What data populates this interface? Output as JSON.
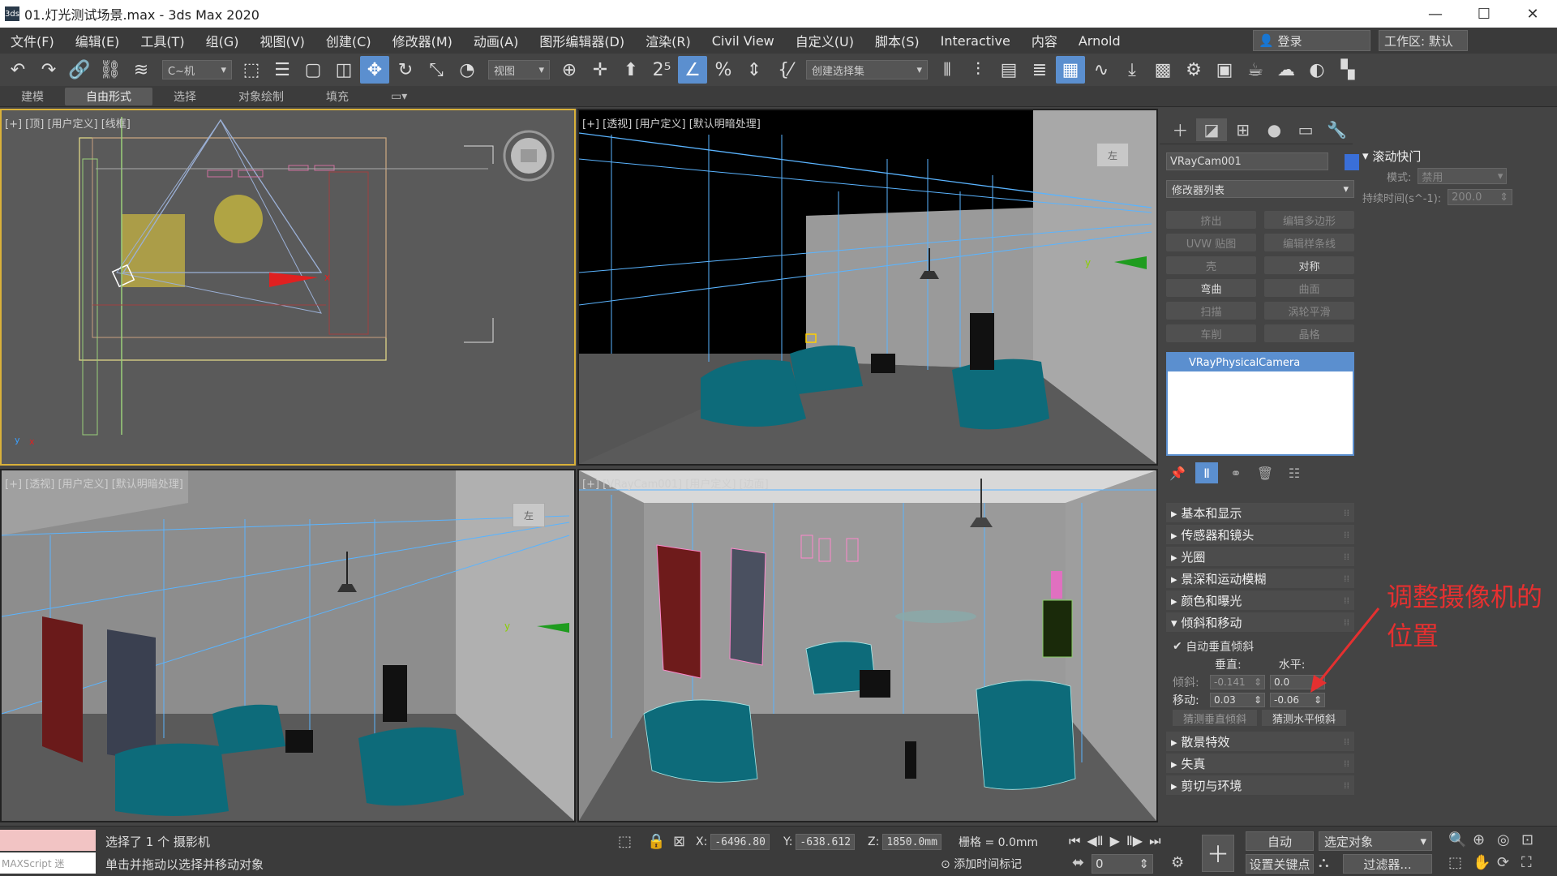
{
  "title": "01.灯光测试场景.max - 3ds Max 2020",
  "app_icon": "3ds",
  "menu": [
    "文件(F)",
    "编辑(E)",
    "工具(T)",
    "组(G)",
    "视图(V)",
    "创建(C)",
    "修改器(M)",
    "动画(A)",
    "图形编辑器(D)",
    "渲染(R)",
    "Civil View",
    "自定义(U)",
    "脚本(S)",
    "Interactive",
    "内容",
    "Arnold"
  ],
  "login": "登录",
  "workspace": "工作区: 默认",
  "toolbar": {
    "selection_filter": "C~机",
    "ref_coord": "视图",
    "named_selection": "创建选择集"
  },
  "ribbon_tabs": [
    "建模",
    "自由形式",
    "选择",
    "对象绘制",
    "填充"
  ],
  "viewports": {
    "top": {
      "label": "[+] [顶] [用户定义] [线框]"
    },
    "persp": {
      "label": "[+] [透视] [用户定义] [默认明暗处理]",
      "cube": "左"
    },
    "persp2": {
      "label": "[+] [透视] [用户定义] [默认明暗处理]",
      "cube": "左"
    },
    "camera": {
      "label": "[+] [VRayCam001] [用户定义] [边面]"
    }
  },
  "command_panel": {
    "object_name": "VRayCam001",
    "object_color": "#3a6fd8",
    "modifier_list": "修改器列表",
    "buttons": [
      {
        "label": "挤出",
        "enabled": false
      },
      {
        "label": "编辑多边形",
        "enabled": false
      },
      {
        "label": "UVW 贴图",
        "enabled": false
      },
      {
        "label": "编辑样条线",
        "enabled": false
      },
      {
        "label": "壳",
        "enabled": false
      },
      {
        "label": "对称",
        "enabled": true
      },
      {
        "label": "弯曲",
        "enabled": true
      },
      {
        "label": "曲面",
        "enabled": false
      },
      {
        "label": "扫描",
        "enabled": false
      },
      {
        "label": "涡轮平滑",
        "enabled": false
      },
      {
        "label": "车削",
        "enabled": false
      },
      {
        "label": "晶格",
        "enabled": false
      }
    ],
    "stack_item": "VRayPhysicalCamera",
    "rollouts": [
      "基本和显示",
      "传感器和镜头",
      "光圈",
      "景深和运动模糊",
      "颜色和曝光",
      "倾斜和移动"
    ],
    "tilt": {
      "auto_label": "自动垂直倾斜",
      "vertical_header": "垂直:",
      "horizontal_header": "水平:",
      "tilt_label": "倾斜:",
      "tilt_v": "-0.141",
      "tilt_h": "0.0",
      "shift_label": "移动:",
      "shift_v": "0.03",
      "shift_h": "-0.06",
      "guess_v": "猜测垂直倾斜",
      "guess_h": "猜测水平倾斜"
    },
    "rollouts_after": [
      "散景特效",
      "失真",
      "剪切与环境"
    ]
  },
  "right_panel": {
    "header": "滚动快门",
    "mode_label": "模式:",
    "mode_value": "禁用",
    "duration_label": "持续时间(s^-1):",
    "duration_value": "200.0"
  },
  "annotation": "调整摄像机的位置",
  "status": {
    "selected": "选择了 1 个 摄影机",
    "hint": "单击并拖动以选择并移动对象",
    "maxscript": "MAXScript 迷",
    "x_label": "X:",
    "x": "-6496.80",
    "y_label": "Y:",
    "y": "-638.612",
    "z_label": "Z:",
    "z": "1850.0mm",
    "grid": "栅格 = 0.0mm",
    "add_time_tag": "添加时间标记",
    "auto": "自动",
    "selected_obj": "选定对象",
    "set_key": "设置关键点",
    "filter": "过滤器...",
    "frame": "0"
  }
}
